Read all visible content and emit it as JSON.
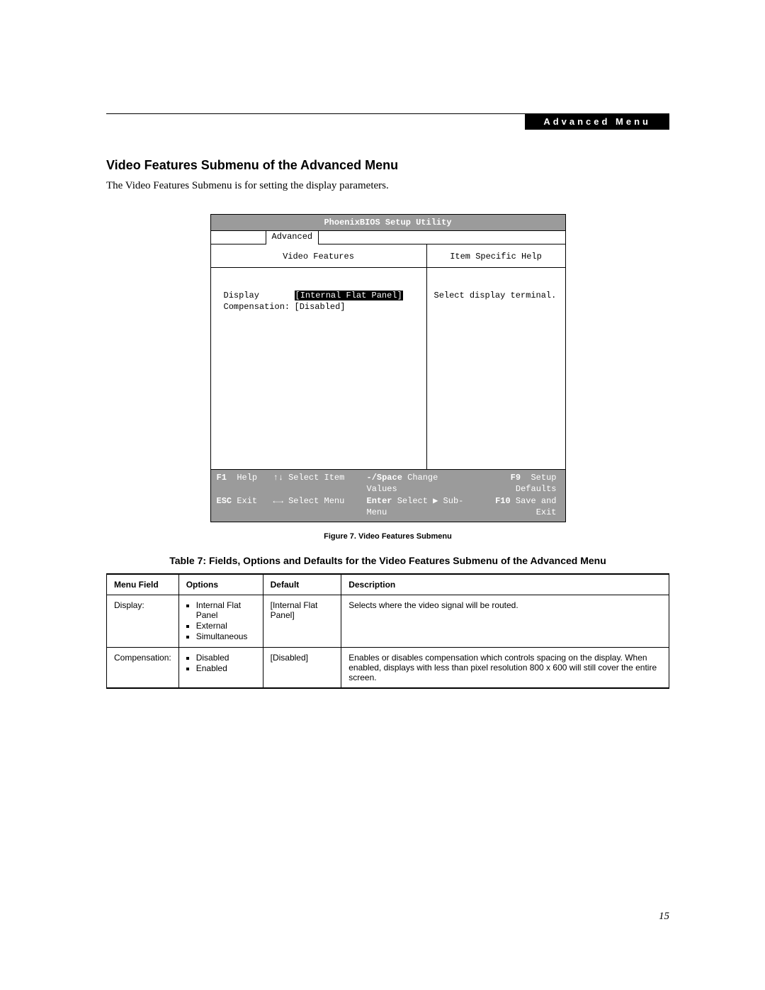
{
  "header": {
    "badge": "Advanced Menu"
  },
  "section": {
    "title": "Video Features Submenu of the Advanced Menu",
    "intro": "The Video Features Submenu is for setting the display parameters."
  },
  "bios": {
    "title": "PhoenixBIOS Setup Utility",
    "tab": "Advanced",
    "left_header": "Video Features",
    "right_header": "Item Specific Help",
    "rows": [
      {
        "label": "Display",
        "value": "[Internal Flat Panel]",
        "selected": true
      },
      {
        "label": "Compensation:",
        "value": "[Disabled]",
        "selected": false
      }
    ],
    "help_text": "Select display terminal.",
    "footer": {
      "line1": [
        {
          "key": "F1",
          "desc": "Help"
        },
        {
          "key": "↑↓",
          "desc": "Select Item"
        },
        {
          "key": "-/Space",
          "desc": "Change Values"
        },
        {
          "key": "F9",
          "desc": "Setup Defaults"
        }
      ],
      "line2": [
        {
          "key": "ESC",
          "desc": "Exit"
        },
        {
          "key": "←→",
          "desc": "Select Menu"
        },
        {
          "key": "Enter",
          "desc": "Select ▶ Sub-Menu"
        },
        {
          "key": "F10",
          "desc": "Save and Exit"
        }
      ]
    }
  },
  "figure_caption": "Figure 7. Video Features Submenu",
  "table_title": "Table 7: Fields, Options and Defaults for the Video Features Submenu of the Advanced Menu",
  "table": {
    "headers": {
      "field": "Menu Field",
      "options": "Options",
      "default": "Default",
      "desc": "Description"
    },
    "rows": [
      {
        "field": "Display:",
        "options": [
          "Internal Flat Panel",
          "External",
          "Simultaneous"
        ],
        "default": "[Internal Flat Panel]",
        "desc": "Selects where the video signal will be routed."
      },
      {
        "field": "Compensation:",
        "options": [
          "Disabled",
          "Enabled"
        ],
        "default": "[Disabled]",
        "desc": "Enables or disables compensation which controls spacing on the display. When enabled, displays with less than pixel resolution 800 x 600 will still cover the entire screen."
      }
    ]
  },
  "page_number": "15"
}
